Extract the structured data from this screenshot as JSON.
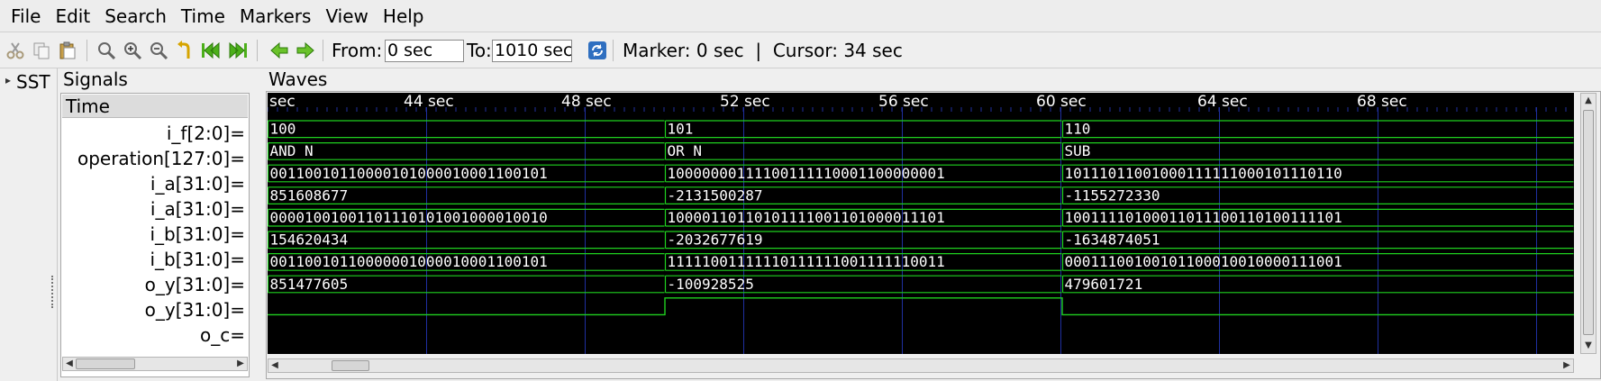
{
  "menu": [
    "File",
    "Edit",
    "Search",
    "Time",
    "Markers",
    "View",
    "Help"
  ],
  "toolbar": {
    "from_label": "From:",
    "from_value": "0 sec",
    "to_label": "To:",
    "to_value": "1010 sec",
    "status": "Marker: 0 sec  |  Cursor: 34 sec"
  },
  "colors": {
    "wave": "#1fd11f",
    "wave_bg": "#000000",
    "grid": "#1f2fa0",
    "text": "#ffffff"
  },
  "sst": {
    "label": "SST"
  },
  "signals": {
    "title": "Signals",
    "header": "Time",
    "rows": [
      "i_f[2:0]=",
      "operation[127:0]=",
      "i_a[31:0]=",
      "i_a[31:0]=",
      "i_b[31:0]=",
      "i_b[31:0]=",
      "o_y[31:0]=",
      "o_y[31:0]=",
      "o_c="
    ]
  },
  "waves": {
    "title": "Waves",
    "ruler": [
      "sec",
      "44 sec",
      "48 sec",
      "52 sec",
      "56 sec",
      "60 sec",
      "64 sec",
      "68 sec"
    ],
    "segments": [
      [
        "100",
        "101",
        "110"
      ],
      [
        "AND N",
        "OR N",
        "SUB"
      ],
      [
        "00110010110000101000010001100101",
        "10000000111100111110001100000001",
        "10111011001000111111000101110110"
      ],
      [
        "851608677",
        "-2131500287",
        "-1155272330"
      ],
      [
        "00001001001101110101001000010010",
        "10000110110101111001101000011101",
        "10011110100011011100110100111101"
      ],
      [
        "154620434",
        "-2032677619",
        "-1634874051"
      ],
      [
        "00110010110000001000010001100101",
        "11111001111110111111001111110011",
        "00011100100101100010010000111001"
      ],
      [
        "851477605",
        "-100928525",
        "479601721"
      ]
    ],
    "o_c_levels": [
      0,
      1,
      0
    ]
  }
}
